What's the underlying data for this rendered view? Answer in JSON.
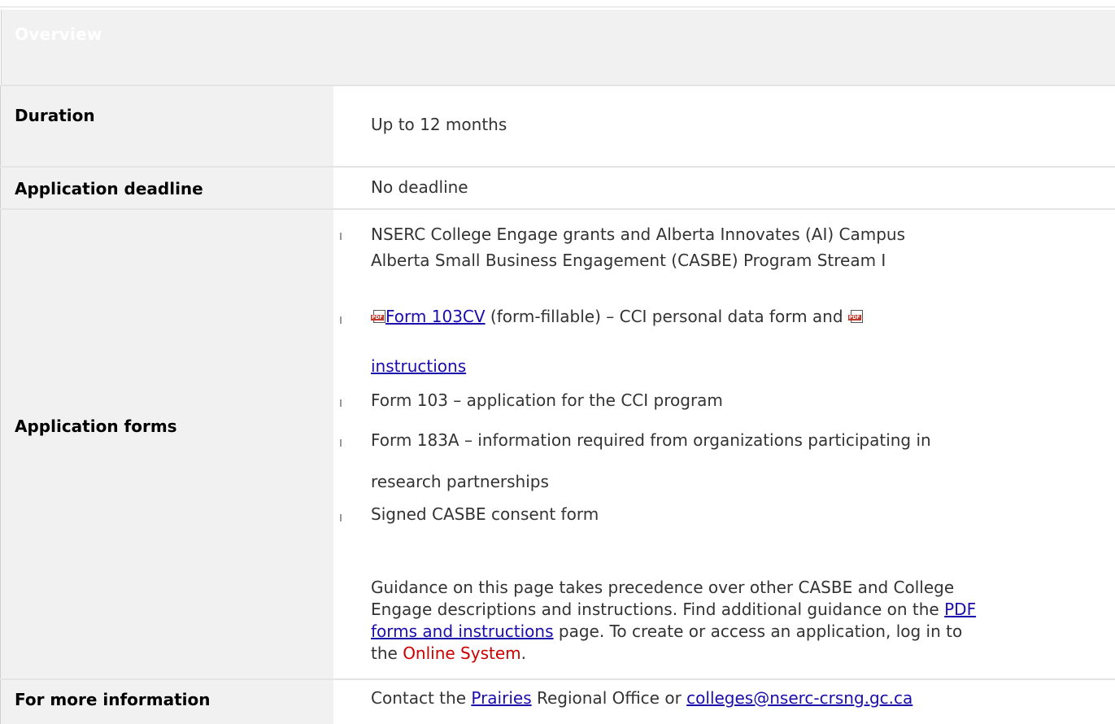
{
  "overview": {
    "title": "Overview"
  },
  "rows": {
    "duration": {
      "label": "Duration",
      "value": "Up to 12 months"
    },
    "deadline": {
      "label": "Application deadline",
      "value": "No deadline"
    },
    "forms": {
      "label": "Application forms",
      "item1_line1": "NSERC College Engage grants and Alberta Innovates (AI) Campus",
      "item1_line2": "Alberta Small Business Engagement (CASBE) Program Stream I",
      "item2_link": "Form 103CV",
      "item2_text": " (form-fillable) – CCI personal data form and ",
      "item2_link2": "instructions",
      "item3": "Form 103 – application for the CCI program",
      "item4_line1": "Form 183A – information required from organizations participating in",
      "item4_line2": "research partnerships",
      "item5": "Signed CASBE consent form",
      "guidance_line1": "Guidance on this page takes precedence over other CASBE and College",
      "guidance_line2_pre": "Engage descriptions and instructions. Find additional guidance on the ",
      "guidance_link1a": "PDF",
      "guidance_link1b": "forms and instructions",
      "guidance_line3_post": " page. To create or access an application, log in to",
      "guidance_line4_pre": "the ",
      "guidance_online": "Online System",
      "guidance_line4_post": "."
    },
    "info": {
      "label": "For more information",
      "pre": "Contact the ",
      "link_prairies": "Prairies",
      "mid": " Regional Office or ",
      "link_email": "colleges@nserc-crsng.gc.ca"
    }
  },
  "icons": {
    "pdf": "pdf-icon"
  }
}
